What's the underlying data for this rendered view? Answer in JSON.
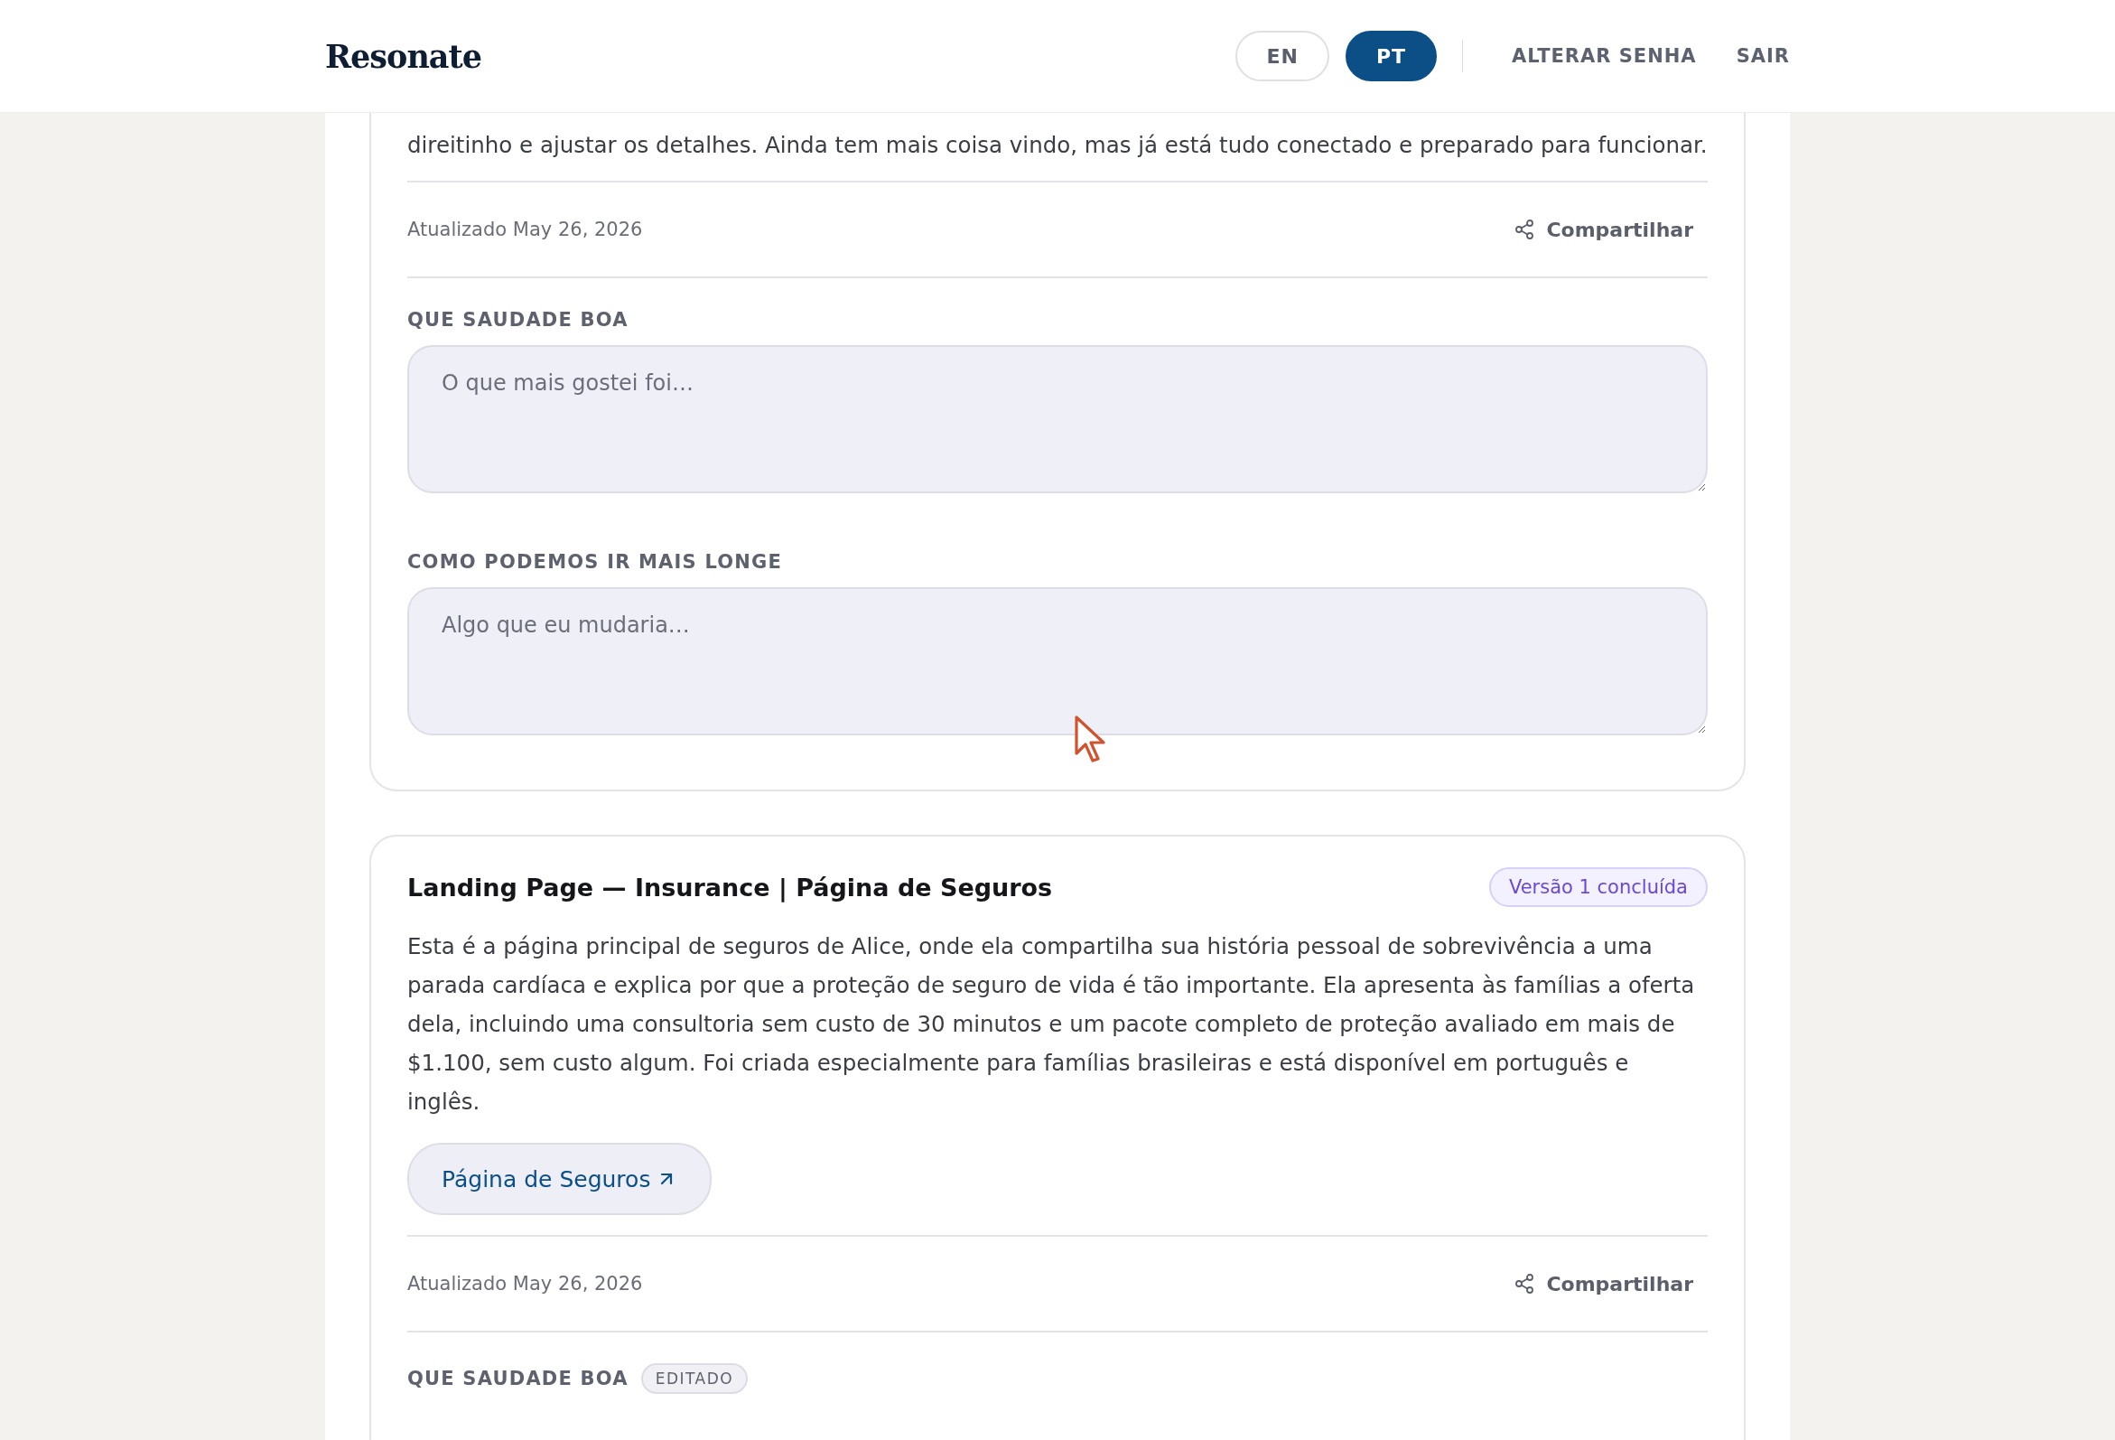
{
  "header": {
    "logo": "Resonate",
    "languages": [
      {
        "label": "EN",
        "selected": false
      },
      {
        "label": "PT",
        "selected": true
      }
    ],
    "links": [
      "ALTERAR SENHA",
      "SAIR"
    ]
  },
  "cards": [
    {
      "description": "direitinho e ajustar os detalhes. Ainda tem mais coisa vindo, mas já está tudo conectado e preparado para funcionar.",
      "updated": "Atualizado May 26, 2026",
      "share": "Compartilhar",
      "feedback": [
        {
          "label": "QUE SAUDADE BOA",
          "placeholder": "O que mais gostei foi…"
        },
        {
          "label": "COMO PODEMOS IR MAIS LONGE",
          "placeholder": "Algo que eu mudaria…"
        }
      ]
    },
    {
      "title": "Landing Page — Insurance | Página de Seguros",
      "status": "Versão 1 concluída",
      "description": "Esta é a página principal de seguros de Alice, onde ela compartilha sua história pessoal de sobrevivência a uma parada cardíaca e explica por que a proteção de seguro de vida é tão importante. Ela apresenta às famílias a oferta dela, incluindo uma consultoria sem custo de 30 minutos e um pacote completo de proteção avaliado em mais de $1.100, sem custo algum. Foi criada especialmente para famílias brasileiras e está disponível em português e inglês.",
      "link": "Página de Seguros",
      "updated": "Atualizado May 26, 2026",
      "share": "Compartilhar",
      "feedback": [
        {
          "label": "QUE SAUDADE BOA",
          "badge": "EDITADO"
        }
      ]
    }
  ]
}
